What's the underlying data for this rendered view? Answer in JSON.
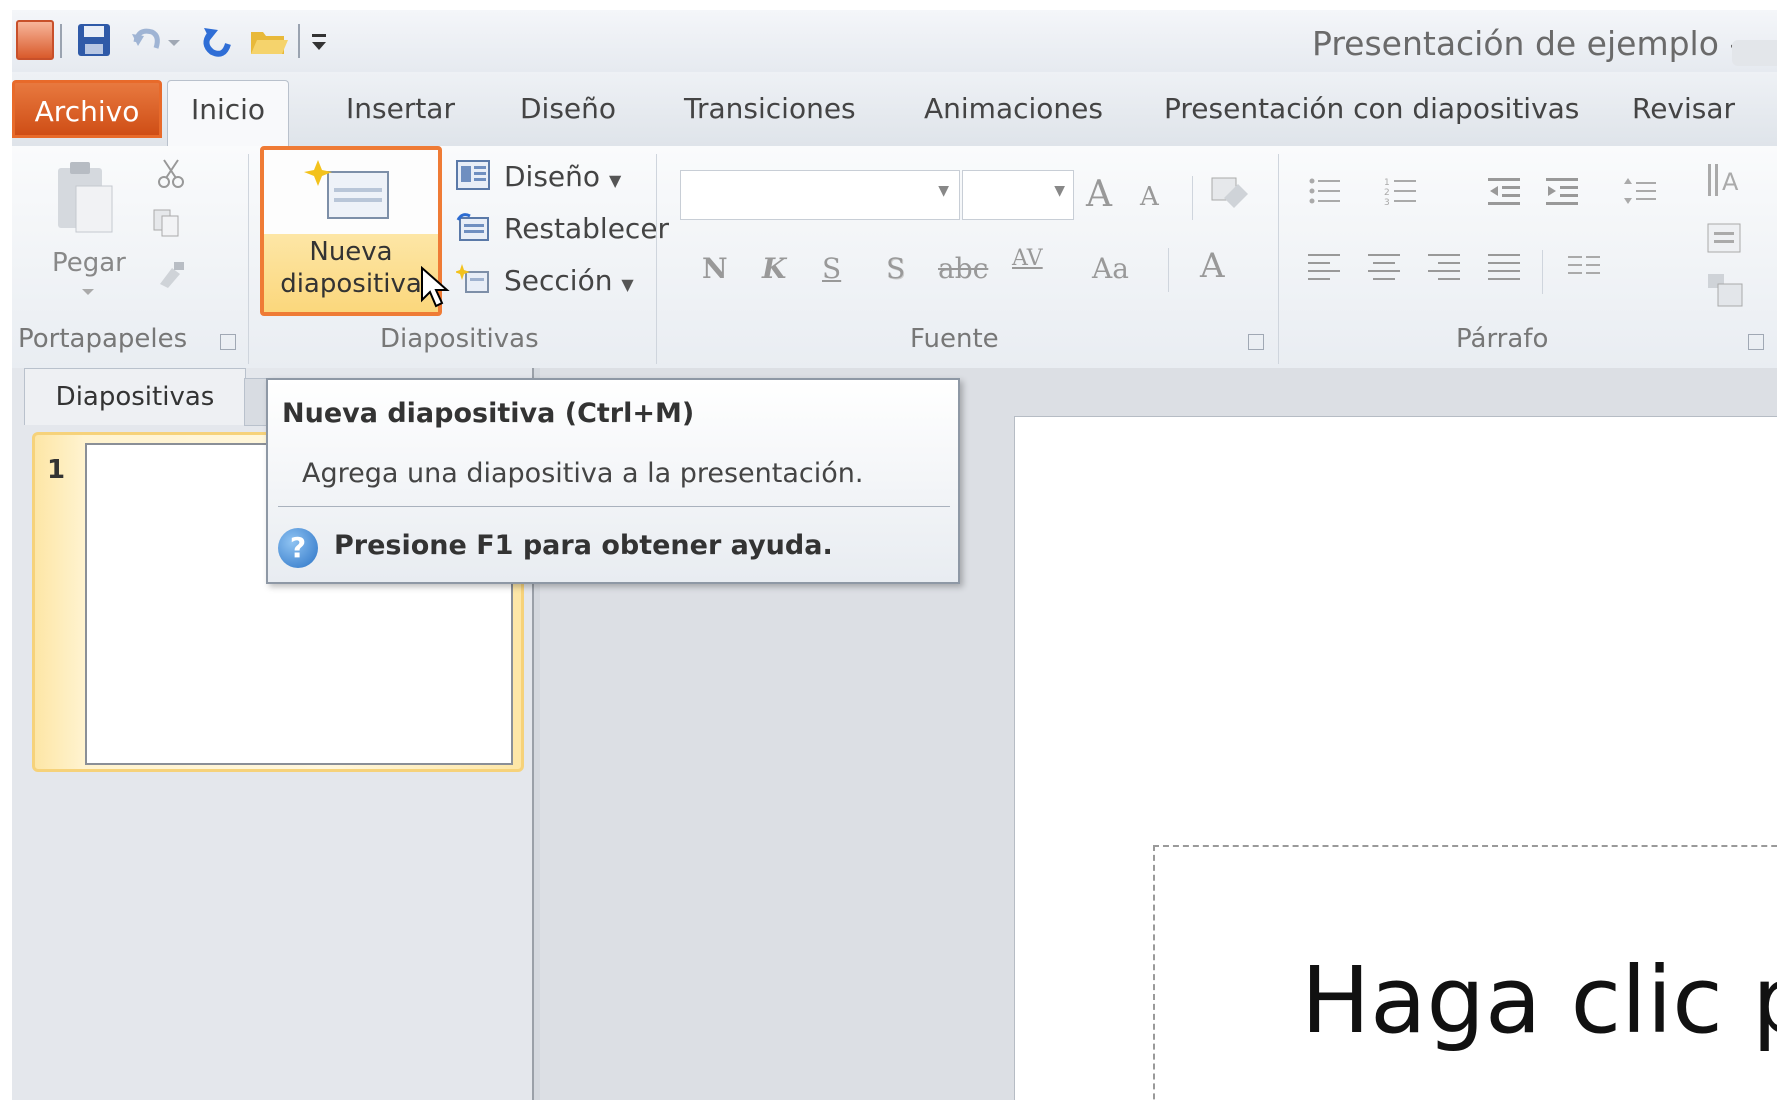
{
  "window": {
    "title": "Presentación de ejemplo  -"
  },
  "ribbon_tabs": [
    {
      "label": "Archivo"
    },
    {
      "label": "Inicio"
    },
    {
      "label": "Insertar"
    },
    {
      "label": "Diseño"
    },
    {
      "label": "Transiciones"
    },
    {
      "label": "Animaciones"
    },
    {
      "label": "Presentación con diapositivas"
    },
    {
      "label": "Revisar"
    }
  ],
  "clipboard": {
    "paste_label": "Pegar",
    "group_label": "Portapapeles"
  },
  "slides_group": {
    "new_slide_label_line1": "Nueva",
    "new_slide_label_line2": "diapositiva",
    "layout_label": "Diseño",
    "reset_label": "Restablecer",
    "section_label": "Sección",
    "group_label": "Diapositivas"
  },
  "font_group": {
    "group_label": "Fuente",
    "bold": "N",
    "italic": "K",
    "underline": "S",
    "shadow": "S",
    "strike": "abc",
    "spacing": "AV",
    "case": "Aa",
    "color": "A",
    "grow": "A",
    "shrink": "A"
  },
  "paragraph_group": {
    "group_label": "Párrafo"
  },
  "left_pane": {
    "tab_label": "Diapositivas",
    "slide_number": "1"
  },
  "tooltip": {
    "title": "Nueva diapositiva (Ctrl+M)",
    "description": "Agrega una diapositiva a la presentación.",
    "help": "Presione F1 para obtener ayuda."
  },
  "slide": {
    "title_placeholder": "Haga clic p"
  },
  "colors": {
    "file_tab": "#d95a2b",
    "highlight_border": "#ef7b35",
    "selected_fill": "#fbd77c"
  }
}
